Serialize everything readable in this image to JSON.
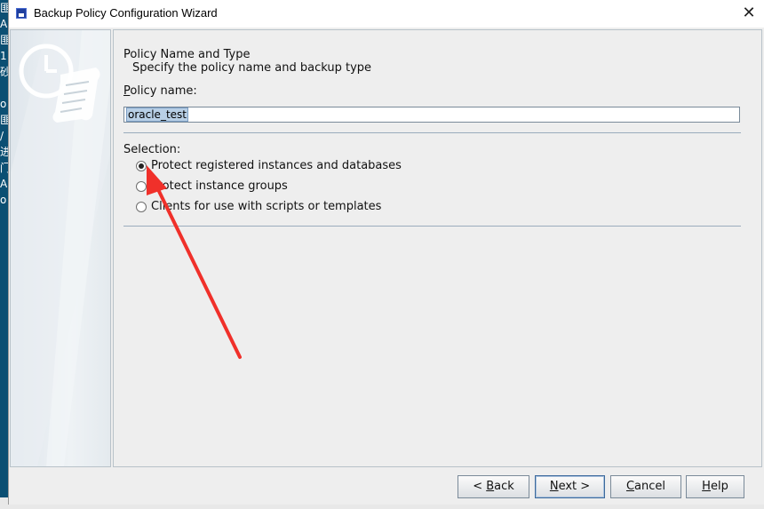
{
  "window": {
    "title": "Backup Policy Configuration Wizard",
    "close_glyph": "✕"
  },
  "background_strip_chars": [
    "匪",
    "A",
    "匪",
    "1",
    "砂",
    "",
    "o",
    "匪",
    "/",
    "进",
    "门",
    "A",
    "o"
  ],
  "page": {
    "heading": "Policy Name and Type",
    "subheading": "Specify the policy name and backup type"
  },
  "policy_name": {
    "label_mnemonic": "P",
    "label_rest": "olicy name:",
    "value": "oracle_test"
  },
  "selection": {
    "label": "Selection:",
    "options": [
      {
        "label": "Protect registered instances and databases",
        "selected": true
      },
      {
        "label": "Protect instance groups",
        "selected": false
      },
      {
        "label": "Clients for use with scripts or templates",
        "selected": false
      }
    ]
  },
  "buttons": {
    "back": {
      "prefix": "< ",
      "mnemonic": "B",
      "rest": "ack"
    },
    "next": {
      "prefix": "",
      "mnemonic": "N",
      "rest": "ext >"
    },
    "cancel": {
      "prefix": "",
      "mnemonic": "C",
      "rest": "ancel"
    },
    "help": {
      "prefix": "",
      "mnemonic": "H",
      "rest": "elp"
    }
  },
  "colors": {
    "annotation_arrow": "#f0302a",
    "panel_border": "#b8c2c9",
    "separator": "#9aabbc"
  }
}
